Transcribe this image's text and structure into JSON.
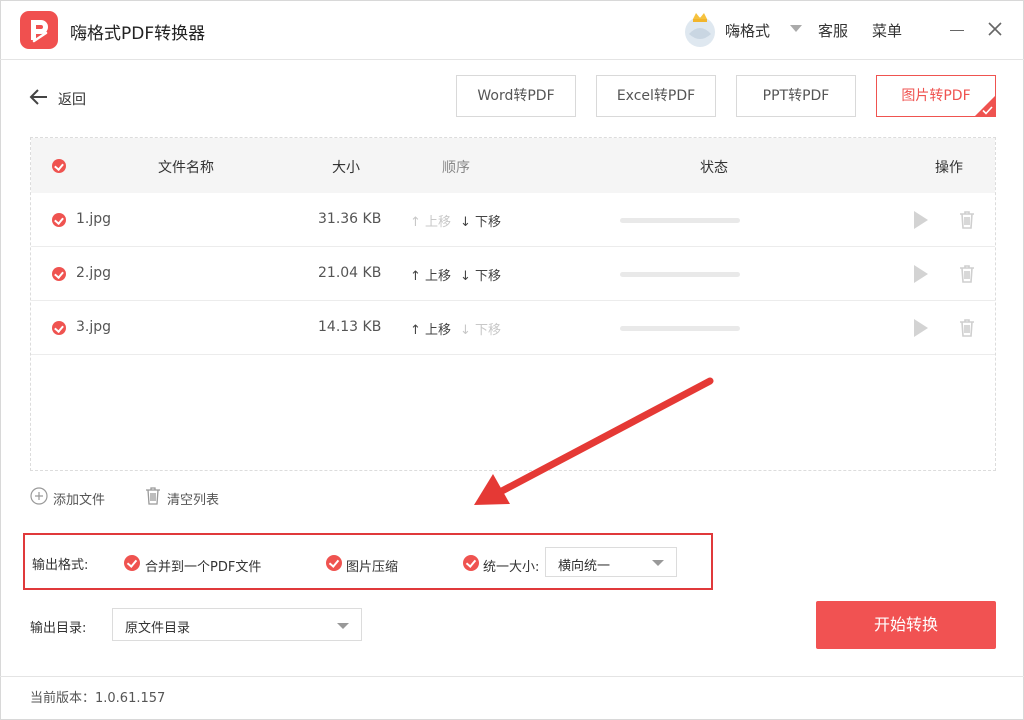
{
  "window": {
    "title": "嗨格式PDF转换器",
    "user_name": "嗨格式",
    "service_label": "客服",
    "menu_label": "菜单"
  },
  "toolbar": {
    "back_label": "返回",
    "tabs": [
      {
        "label": "Word转PDF",
        "active": false
      },
      {
        "label": "Excel转PDF",
        "active": false
      },
      {
        "label": "PPT转PDF",
        "active": false
      },
      {
        "label": "图片转PDF",
        "active": true
      }
    ]
  },
  "table": {
    "headers": {
      "name": "文件名称",
      "size": "大小",
      "order": "顺序",
      "status": "状态",
      "action": "操作"
    },
    "move_up_label": "上移",
    "move_down_label": "下移",
    "rows": [
      {
        "name": "1.jpg",
        "size": "31.36 KB",
        "up_enabled": false,
        "down_enabled": true,
        "progress": 0
      },
      {
        "name": "2.jpg",
        "size": "21.04 KB",
        "up_enabled": true,
        "down_enabled": true,
        "progress": 0
      },
      {
        "name": "3.jpg",
        "size": "14.13 KB",
        "up_enabled": true,
        "down_enabled": false,
        "progress": 0
      }
    ]
  },
  "actions": {
    "add_file": "添加文件",
    "clear_list": "清空列表"
  },
  "output": {
    "format_label": "输出格式:",
    "merge_option": "合并到一个PDF文件",
    "compress_option": "图片压缩",
    "unify_size_option": "统一大小:",
    "unify_size_value": "横向统一",
    "dir_label": "输出目录:",
    "dir_value": "原文件目录"
  },
  "start_button": "开始转换",
  "footer": {
    "version": "当前版本：1.0.61.157"
  },
  "colors": {
    "accent": "#ef5350",
    "annotation": "#e0393b"
  }
}
